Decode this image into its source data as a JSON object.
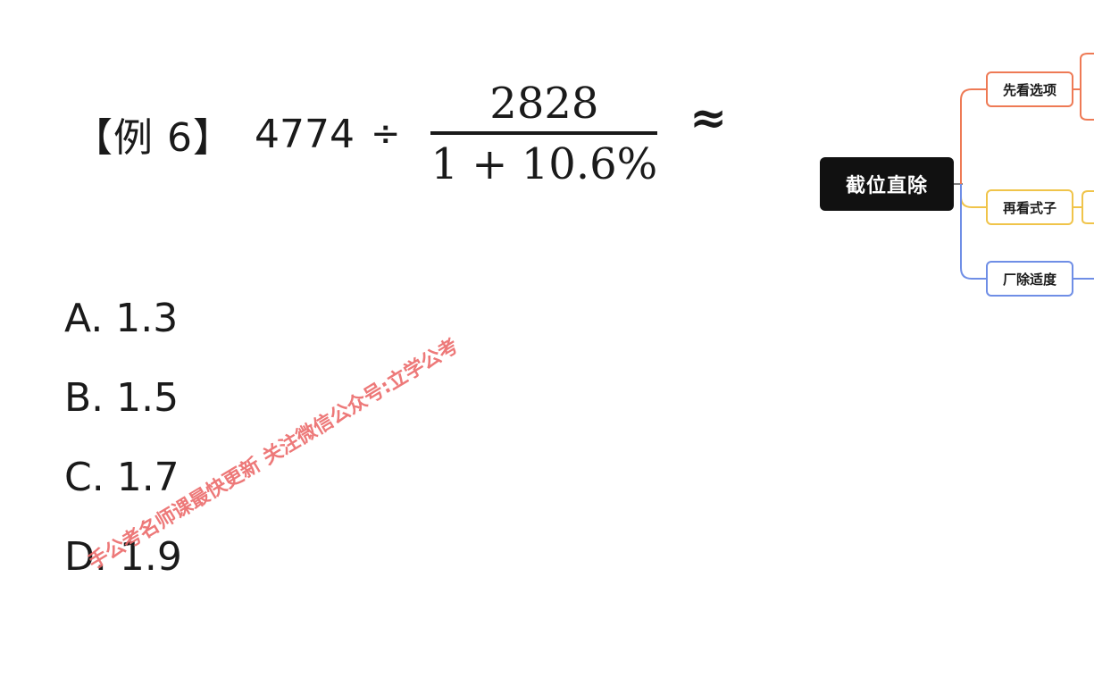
{
  "problem": {
    "label": "【例 6】",
    "dividend": "4774",
    "divide_symbol": "÷",
    "numerator": "2828",
    "denominator": "1 + 10.6%",
    "approx_symbol": "≈"
  },
  "options": [
    {
      "text": "A. 1.3"
    },
    {
      "text": "B. 1.5"
    },
    {
      "text": "C. 1.7"
    },
    {
      "text": "D. 1.9"
    }
  ],
  "mindmap": {
    "root": "截位直除",
    "nodes": [
      {
        "label": "先看选项",
        "color": "#ee7a55"
      },
      {
        "label": "再看式子",
        "color": "#f0c44a"
      },
      {
        "label": "厂除适度",
        "color": "#6f8ee6"
      }
    ]
  },
  "watermark": "手公考名师课最快更新 关注微信公众号:立学公考"
}
